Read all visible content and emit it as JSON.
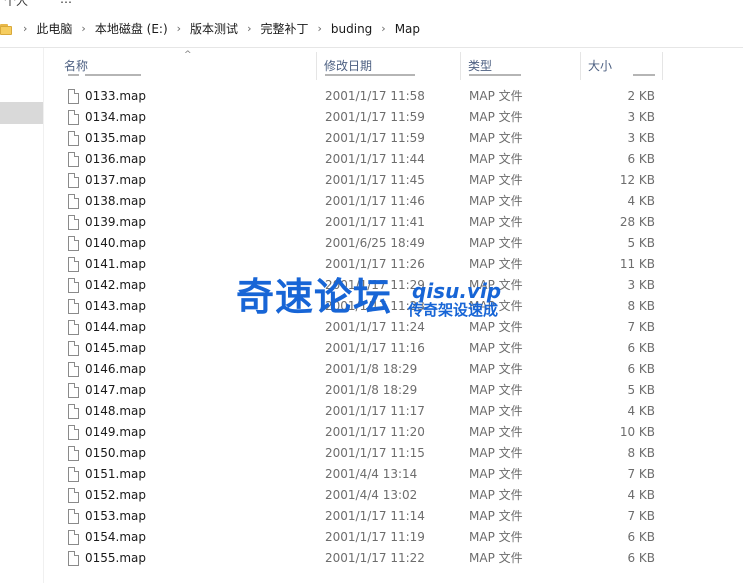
{
  "window_fragment": {
    "left": "个人",
    "right": "…"
  },
  "breadcrumb": {
    "items": [
      "此电脑",
      "本地磁盘 (E:)",
      "版本测试",
      "完整补丁",
      "buding",
      "Map"
    ],
    "separator": "›"
  },
  "columns": {
    "name": "名称",
    "date": "修改日期",
    "type": "类型",
    "size": "大小",
    "sort_indicator": "^"
  },
  "files": [
    {
      "name": "0133.map",
      "date": "2001/1/17 11:58",
      "type": "MAP 文件",
      "size": "2 KB"
    },
    {
      "name": "0134.map",
      "date": "2001/1/17 11:59",
      "type": "MAP 文件",
      "size": "3 KB"
    },
    {
      "name": "0135.map",
      "date": "2001/1/17 11:59",
      "type": "MAP 文件",
      "size": "3 KB"
    },
    {
      "name": "0136.map",
      "date": "2001/1/17 11:44",
      "type": "MAP 文件",
      "size": "6 KB"
    },
    {
      "name": "0137.map",
      "date": "2001/1/17 11:45",
      "type": "MAP 文件",
      "size": "12 KB"
    },
    {
      "name": "0138.map",
      "date": "2001/1/17 11:46",
      "type": "MAP 文件",
      "size": "4 KB"
    },
    {
      "name": "0139.map",
      "date": "2001/1/17 11:41",
      "type": "MAP 文件",
      "size": "28 KB"
    },
    {
      "name": "0140.map",
      "date": "2001/6/25 18:49",
      "type": "MAP 文件",
      "size": "5 KB"
    },
    {
      "name": "0141.map",
      "date": "2001/1/17 11:26",
      "type": "MAP 文件",
      "size": "11 KB"
    },
    {
      "name": "0142.map",
      "date": "2001/1/17 11:29",
      "type": "MAP 文件",
      "size": "3 KB"
    },
    {
      "name": "0143.map",
      "date": "2001/1/17 11:23",
      "type": "MAP 文件",
      "size": "8 KB"
    },
    {
      "name": "0144.map",
      "date": "2001/1/17 11:24",
      "type": "MAP 文件",
      "size": "7 KB"
    },
    {
      "name": "0145.map",
      "date": "2001/1/17 11:16",
      "type": "MAP 文件",
      "size": "6 KB"
    },
    {
      "name": "0146.map",
      "date": "2001/1/8 18:29",
      "type": "MAP 文件",
      "size": "6 KB"
    },
    {
      "name": "0147.map",
      "date": "2001/1/8 18:29",
      "type": "MAP 文件",
      "size": "5 KB"
    },
    {
      "name": "0148.map",
      "date": "2001/1/17 11:17",
      "type": "MAP 文件",
      "size": "4 KB"
    },
    {
      "name": "0149.map",
      "date": "2001/1/17 11:20",
      "type": "MAP 文件",
      "size": "10 KB"
    },
    {
      "name": "0150.map",
      "date": "2001/1/17 11:15",
      "type": "MAP 文件",
      "size": "8 KB"
    },
    {
      "name": "0151.map",
      "date": "2001/4/4 13:14",
      "type": "MAP 文件",
      "size": "7 KB"
    },
    {
      "name": "0152.map",
      "date": "2001/4/4 13:02",
      "type": "MAP 文件",
      "size": "4 KB"
    },
    {
      "name": "0153.map",
      "date": "2001/1/17 11:14",
      "type": "MAP 文件",
      "size": "7 KB"
    },
    {
      "name": "0154.map",
      "date": "2001/1/17 11:19",
      "type": "MAP 文件",
      "size": "6 KB"
    },
    {
      "name": "0155.map",
      "date": "2001/1/17 11:22",
      "type": "MAP 文件",
      "size": "6 KB"
    }
  ],
  "watermark": {
    "main": "奇速论坛",
    "domain": "qisu.vip",
    "sub": "传奇架设速成"
  },
  "colors": {
    "watermark": "#1765d6",
    "header_text": "#4d6082",
    "meta_text": "#6d6d6d"
  }
}
